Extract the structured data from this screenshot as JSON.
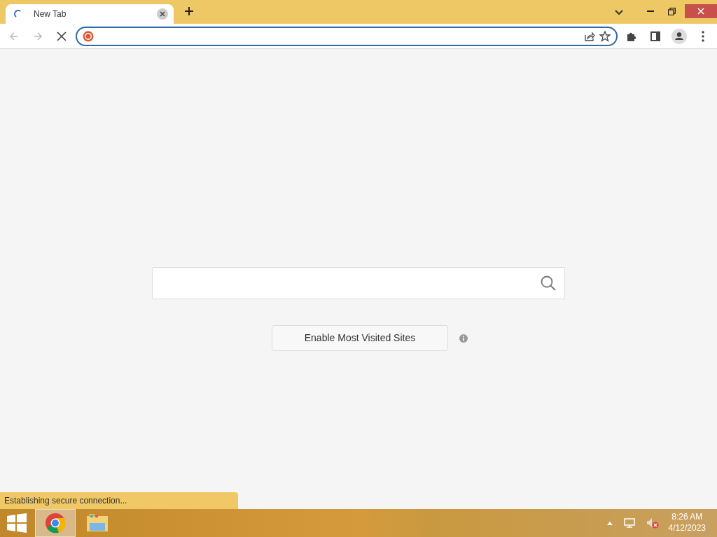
{
  "tabs": [
    {
      "title": "New Tab",
      "selected": true,
      "loading": true
    }
  ],
  "toolbar": {
    "forward_disabled": true,
    "back_disabled": true,
    "loading": true
  },
  "page": {
    "button": "Enable Most Visited Sites"
  },
  "status_bar": {
    "text": "Establishing secure connection..."
  },
  "taskbar": {
    "apps": [
      {
        "kind": "browser",
        "selected": true
      },
      {
        "kind": "files",
        "selected": false
      }
    ],
    "time": "8:26 AM",
    "date": "4/12/2023"
  }
}
